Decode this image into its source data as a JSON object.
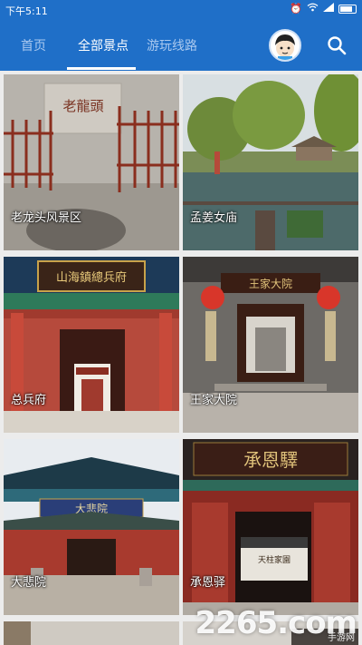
{
  "status_bar": {
    "time": "下午5:11",
    "icons": [
      "alarm-icon",
      "wifi-icon",
      "signal-icon",
      "battery-icon"
    ]
  },
  "tabs": [
    {
      "label": "首页",
      "active": false
    },
    {
      "label": "全部景点",
      "active": true
    },
    {
      "label": "游玩线路",
      "active": false
    }
  ],
  "spots": [
    {
      "name": "老龙头风景区"
    },
    {
      "name": "孟姜女庙"
    },
    {
      "name": "总兵府"
    },
    {
      "name": "王家大院"
    },
    {
      "name": "大悲院"
    },
    {
      "name": "承恩驿"
    }
  ],
  "signs": {
    "laolongtou": "老龍頭",
    "zongbingfu": "山海鎮總兵府",
    "wangjia": "王家大院",
    "dabeiyuan": "大悲院",
    "chengenyi": "承恩驛",
    "tianzhu": "天柱家園"
  },
  "watermark": {
    "main": "2265.com",
    "sub": "手游网"
  },
  "colors": {
    "appbar": "#1f6fc8",
    "tab_inactive": "#a9c8ef"
  }
}
